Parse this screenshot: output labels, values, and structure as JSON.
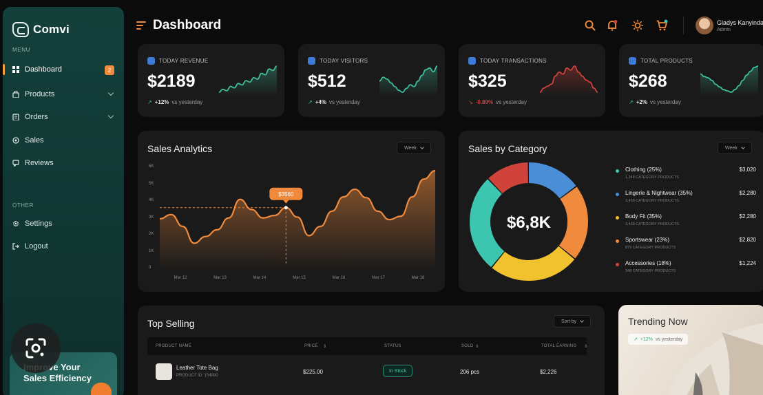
{
  "sidebar": {
    "brand": "Comvi",
    "menu_label": "MENU",
    "other_label": "OTHER",
    "items": [
      {
        "label": "Dashboard",
        "badge": "2"
      },
      {
        "label": "Products"
      },
      {
        "label": "Orders"
      },
      {
        "label": "Sales"
      },
      {
        "label": "Reviews"
      }
    ],
    "other_items": [
      {
        "label": "Settings"
      },
      {
        "label": "Logout"
      }
    ],
    "promo_title": "Improve Your Sales Efficiency"
  },
  "header": {
    "title": "Dashboard",
    "user_name": "Gladys Kanyinda",
    "user_role": "Admin"
  },
  "stats": [
    {
      "label": "TODAY REVENUE",
      "value": "$2189",
      "delta": "+12%",
      "delta_text": "vs yesterday",
      "trend": "up",
      "color": "#3fbf9b",
      "spark": [
        10,
        12,
        11,
        14,
        13,
        16,
        15,
        18,
        17,
        20,
        19,
        23,
        22,
        26,
        25,
        28
      ]
    },
    {
      "label": "TODAY VISITORS",
      "value": "$512",
      "delta": "+4%",
      "delta_text": "vs yesterday",
      "trend": "up",
      "color": "#3fbf9b",
      "spark": [
        18,
        20,
        19,
        17,
        15,
        13,
        12,
        14,
        16,
        15,
        18,
        21,
        24,
        25,
        23,
        26
      ]
    },
    {
      "label": "TODAY TRANSACTIONS",
      "value": "$325",
      "delta": "-0.89%",
      "delta_text": "vs yesterday",
      "trend": "down",
      "color": "#d0433b",
      "spark": [
        14,
        16,
        17,
        18,
        22,
        24,
        23,
        26,
        25,
        27,
        24,
        22,
        20,
        19,
        16,
        14
      ]
    },
    {
      "label": "TOTAL PRODUCTS",
      "value": "$268",
      "delta": "+2%",
      "delta_text": "vs yesterday",
      "trend": "up",
      "color": "#3fbf9b",
      "spark": [
        22,
        20,
        19,
        17,
        14,
        12,
        10,
        9,
        8,
        10,
        13,
        17,
        21,
        24,
        27,
        28
      ]
    }
  ],
  "sales_analytics": {
    "title": "Sales Analytics",
    "period": "Week",
    "tooltip": "$3560"
  },
  "sales_by_category": {
    "title": "Sales by Category",
    "period": "Week",
    "total": "$6,8K"
  },
  "chart_data": [
    {
      "type": "area",
      "title": "Sales Analytics",
      "x": [
        "Mar 12",
        "Mar 13",
        "Mar 14",
        "Mar 15",
        "Mar 16",
        "Mar 17",
        "Mar 18"
      ],
      "y_ticks": [
        "6K",
        "5K",
        "4K",
        "3K",
        "2K",
        "1K",
        "0"
      ],
      "ylim": [
        0,
        6000
      ],
      "color": "#f08a3c",
      "series": [
        {
          "values": [
            2900,
            3150,
            2450,
            1450,
            1850,
            2250,
            2950,
            4050,
            3450,
            2950,
            3100,
            3560,
            3000,
            1900,
            2450,
            3350,
            4200,
            4650,
            4150,
            3350,
            2850,
            3050,
            4200,
            5250,
            5750
          ]
        }
      ],
      "highlight": {
        "index": 11,
        "label": "$3560"
      }
    },
    {
      "type": "pie",
      "title": "Sales by Category",
      "total_label": "$6,8K",
      "categories": [
        "Clothing (25%)",
        "Lingerie & Nightwear (35%)",
        "Body Fit (35%)",
        "Sportswear (23%)",
        "Accessories (18%)"
      ],
      "subtitles": [
        "1,348 CATEGORY PRODUCTS",
        "3,459 CATEGORY PRODUCTS",
        "3,459 CATEGORY PRODUCTS",
        "879 CATEGORY PRODUCTS",
        "348 CATEGORY PRODUCTS"
      ],
      "amounts": [
        "$3,020",
        "$2,280",
        "$2,280",
        "$2,820",
        "$1,224"
      ],
      "colors": [
        "#3cc6b0",
        "#4a8ed8",
        "#f2c22e",
        "#f08a3c",
        "#d0433b"
      ],
      "ring_segments": [
        {
          "color": "#4a8ed8",
          "value": 15
        },
        {
          "color": "#f08a3c",
          "value": 21
        },
        {
          "color": "#f2c22e",
          "value": 25
        },
        {
          "color": "#3cc6b0",
          "value": 27
        },
        {
          "color": "#d0433b",
          "value": 12
        }
      ]
    }
  ],
  "top_selling": {
    "title": "Top Selling",
    "sort_label": "Sort by",
    "columns": [
      "PRODUCT NAME",
      "PRICE",
      "STATUS",
      "SOLD",
      "TOTAL EARNING"
    ],
    "rows": [
      {
        "name": "Leather Tote Bag",
        "id": "PRODUCT ID: 154890",
        "price": "$225.00",
        "status": "In Stock",
        "sold": "206 pcs",
        "earning": "$2,226"
      }
    ]
  },
  "trending": {
    "title": "Trending Now",
    "delta": "+12%",
    "delta_text": "vs yesterday"
  }
}
